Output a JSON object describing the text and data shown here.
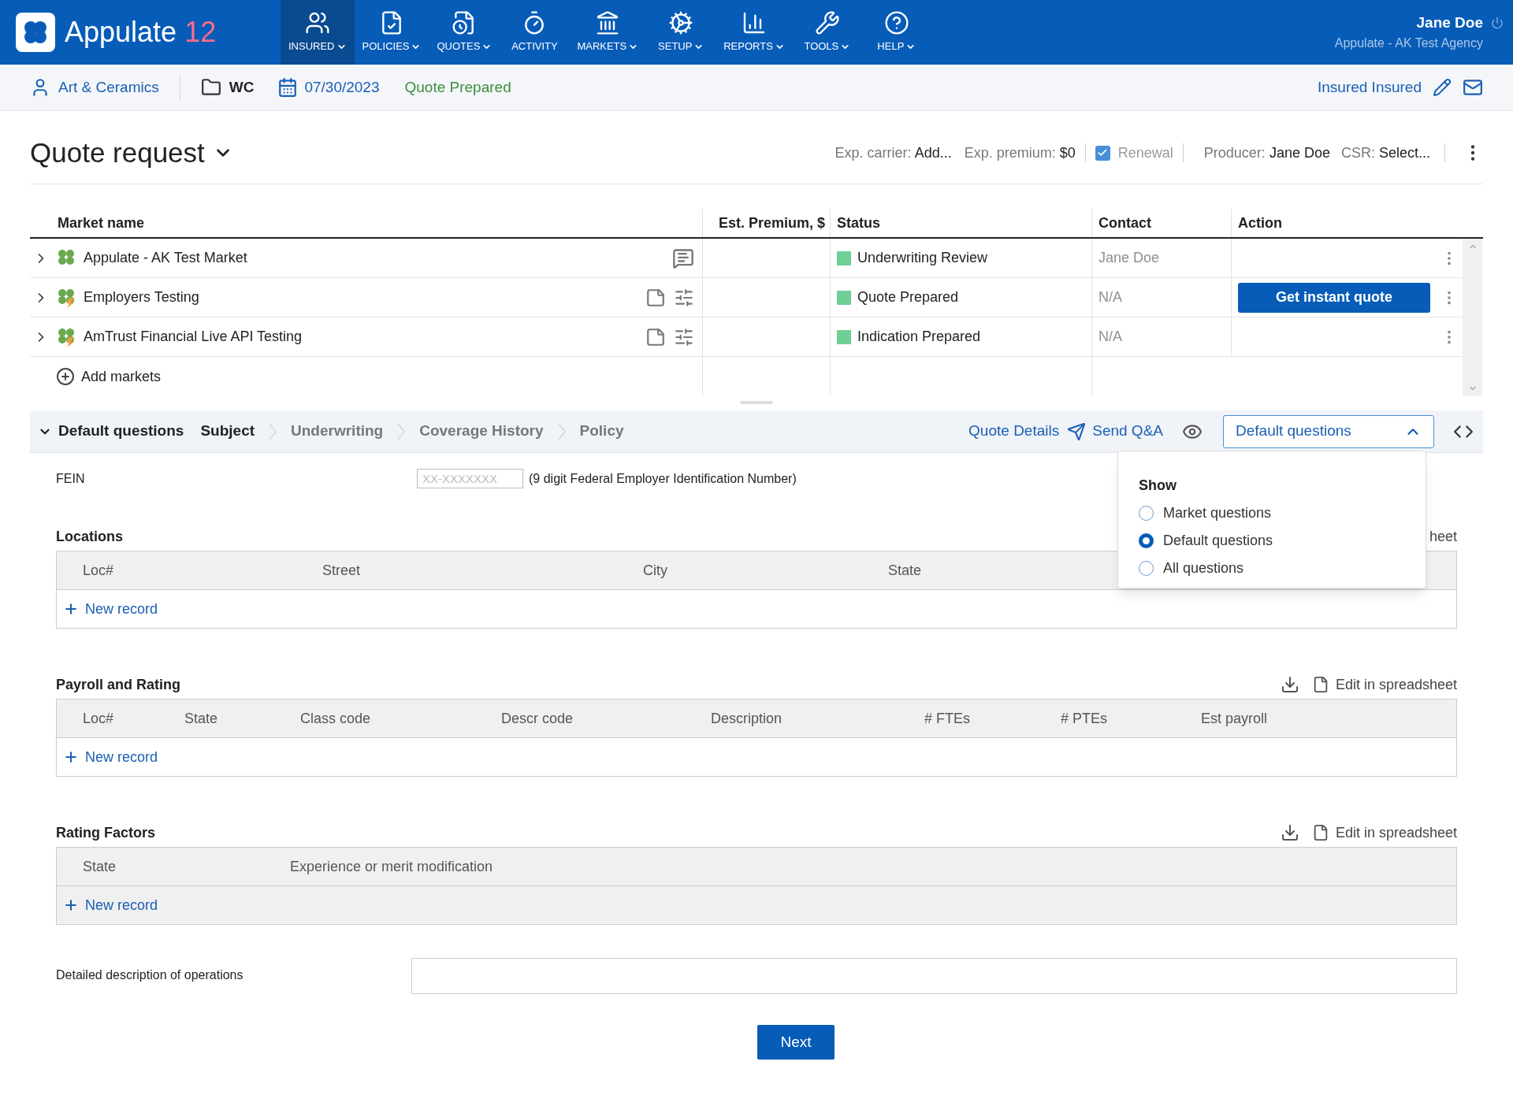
{
  "app": {
    "name": "Appulate",
    "version": "12"
  },
  "nav": [
    {
      "label": "INSURED",
      "selected": true,
      "caret": true,
      "kind": "users"
    },
    {
      "label": "POLICIES",
      "selected": false,
      "caret": true,
      "kind": "policy"
    },
    {
      "label": "QUOTES",
      "selected": false,
      "caret": true,
      "kind": "quote"
    },
    {
      "label": "ACTIVITY",
      "selected": false,
      "caret": false,
      "kind": "activity"
    },
    {
      "label": "MARKETS",
      "selected": false,
      "caret": true,
      "kind": "markets"
    },
    {
      "label": "SETUP",
      "selected": false,
      "caret": true,
      "kind": "setup"
    },
    {
      "label": "REPORTS",
      "selected": false,
      "caret": true,
      "kind": "reports"
    },
    {
      "label": "TOOLS",
      "selected": false,
      "caret": true,
      "kind": "tools"
    },
    {
      "label": "HELP",
      "selected": false,
      "caret": true,
      "kind": "help"
    }
  ],
  "user": {
    "name": "Jane Doe",
    "agency": "Appulate - AK Test Agency"
  },
  "context_bar": {
    "insured": "Art & Ceramics",
    "line": "WC",
    "date": "07/30/2023",
    "status": "Quote Prepared",
    "contact": "Insured Insured"
  },
  "header": {
    "title": "Quote request",
    "meta": [
      {
        "label": "Exp. carrier:",
        "value": "Add..."
      },
      {
        "label": "Exp. premium:",
        "value": "$0"
      }
    ],
    "renewal": {
      "label": "Renewal",
      "checked": true
    },
    "meta2": [
      {
        "label": "Producer:",
        "value": "Jane Doe"
      },
      {
        "label": "CSR:",
        "value": "Select..."
      }
    ]
  },
  "markets_table": {
    "columns": [
      "Market name",
      "Est. Premium, $",
      "Status",
      "Contact",
      "Action"
    ],
    "rows": [
      {
        "name": "Appulate - AK Test Market",
        "kind": "plain",
        "status": "Underwriting Review",
        "contact": "Jane Doe"
      },
      {
        "name": "Employers Testing",
        "kind": "api",
        "status": "Quote Prepared",
        "contact": "N/A",
        "action": "Get instant quote"
      },
      {
        "name": "AmTrust Financial Live API Testing",
        "kind": "api",
        "status": "Indication Prepared",
        "contact": "N/A"
      }
    ],
    "add_label": "Add markets"
  },
  "questions_bar": {
    "toggle": "Default questions",
    "steps": [
      {
        "label": "Subject",
        "selected": true
      },
      {
        "label": "Underwriting",
        "selected": false
      },
      {
        "label": "Coverage History",
        "selected": false
      },
      {
        "label": "Policy",
        "selected": false
      }
    ],
    "quote_details": "Quote Details",
    "send": "Send Q&A",
    "select": "Default questions",
    "expanded": true
  },
  "show_menu": {
    "title": "Show",
    "options": [
      {
        "label": "Market questions",
        "selected": false
      },
      {
        "label": "Default questions",
        "selected": true
      },
      {
        "label": "All questions",
        "selected": false
      }
    ]
  },
  "fein": {
    "label": "FEIN",
    "placeholder": "XX-XXXXXXX",
    "hint": "(9 digit Federal Employer Identification Number)"
  },
  "sections": [
    {
      "title": "Locations",
      "kind": "partial",
      "action": "heet",
      "columns": [
        "Loc#",
        "Street",
        "City",
        "State"
      ],
      "add_label": "New record"
    },
    {
      "title": "Payroll and Rating",
      "kind": "spreadsheet",
      "action": "Edit in spreadsheet",
      "columns": [
        "Loc#",
        "State",
        "Class code",
        "Descr code",
        "Description",
        "# FTEs",
        "# PTEs",
        "Est payroll"
      ],
      "add_label": "New record"
    },
    {
      "title": "Rating Factors",
      "kind": "spreadsheet",
      "action": "Edit in spreadsheet",
      "columns": [
        "State",
        "Experience or merit modification"
      ],
      "add_label": "New record"
    }
  ],
  "description": {
    "label": "Detailed description of operations"
  },
  "next": "Next"
}
